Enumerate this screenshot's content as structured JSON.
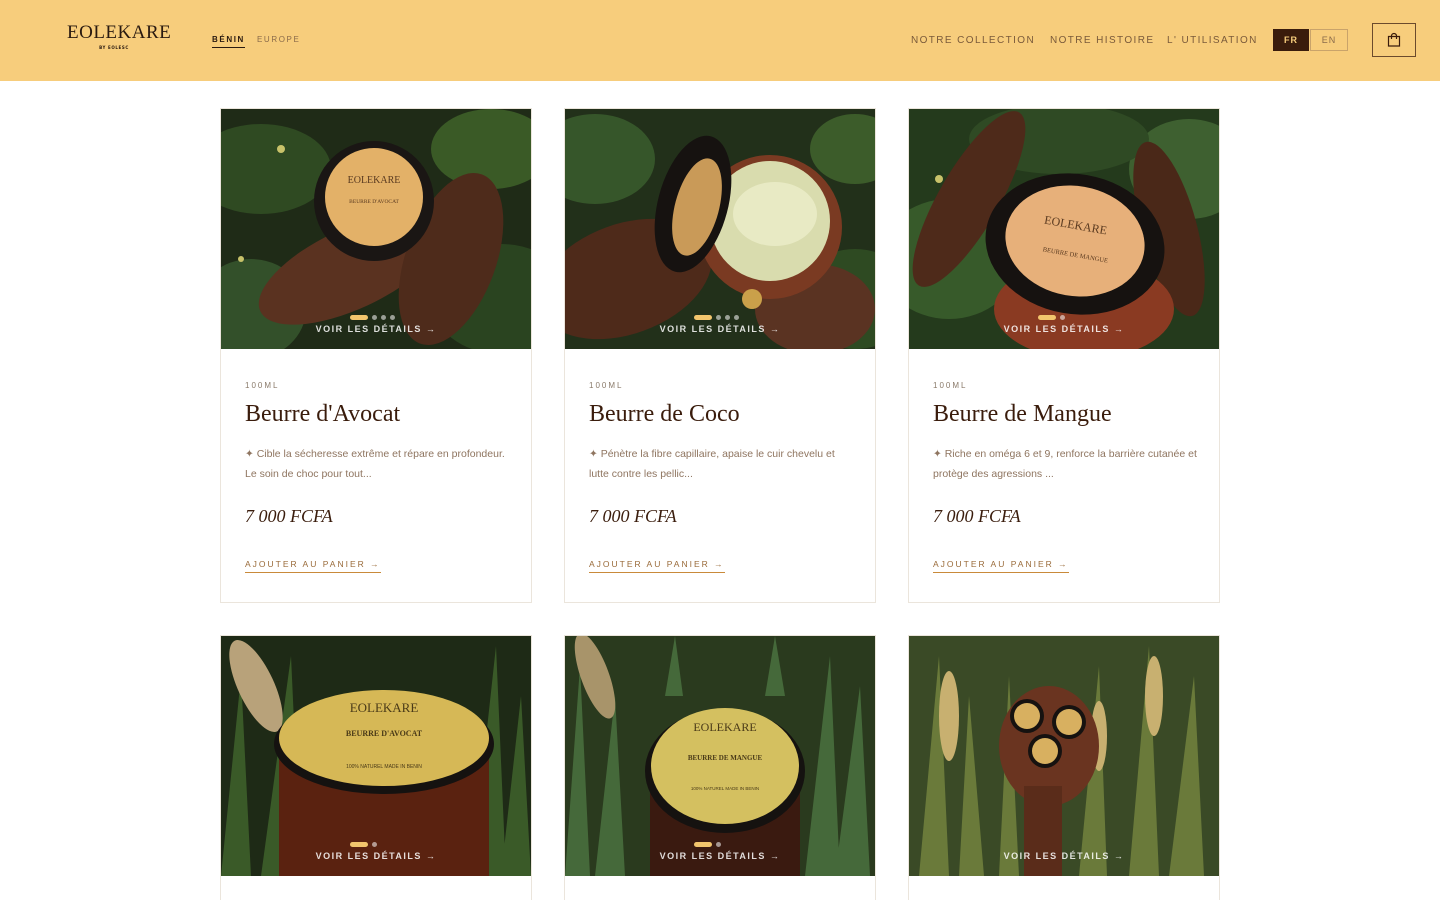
{
  "brand": {
    "name": "EOLEKARE",
    "tagline": "BY EOLESC"
  },
  "regions": {
    "benin": "BÉNIN",
    "europe": "EUROPE"
  },
  "nav": {
    "collection": "NOTRE COLLECTION",
    "histoire": "NOTRE HISTOIRE",
    "utilisation": "L' UTILISATION"
  },
  "lang": {
    "fr": "FR",
    "en": "EN"
  },
  "icons": {
    "cart": "shopping-bag-icon"
  },
  "colors": {
    "header_bg": "#f7cd7c",
    "accent_dark": "#3a1c0c",
    "dot_active": "#f2c56d"
  },
  "products": [
    {
      "volume": "100ML",
      "name": "Beurre d'Avocat",
      "desc": "✦ Cible la sécheresse extrême et répare en profondeur. Le soin de choc pour tout...",
      "price": "7 000 FCFA",
      "add": "AJOUTER AU PANIER →",
      "view": "VOIR LES DÉTAILS →",
      "jar_label": "BEURRE D'AVOCAT",
      "image_count": 4,
      "active_image": 1
    },
    {
      "volume": "100ML",
      "name": "Beurre de Coco",
      "desc": "✦ Pénètre la fibre capillaire, apaise le cuir chevelu et lutte contre les pellic...",
      "price": "7 000 FCFA",
      "add": "AJOUTER AU PANIER →",
      "view": "VOIR LES DÉTAILS →",
      "jar_label": "",
      "image_count": 4,
      "active_image": 1
    },
    {
      "volume": "100ML",
      "name": "Beurre de Mangue",
      "desc": "✦ Riche en oméga 6 et 9, renforce la barrière cutanée et protège des agressions ...",
      "price": "7 000 FCFA",
      "add": "AJOUTER AU PANIER →",
      "view": "VOIR LES DÉTAILS →",
      "jar_label": "BEURRE DE MANGUE",
      "image_count": 2,
      "active_image": 1
    },
    {
      "view": "VOIR LES DÉTAILS →",
      "jar_label": "BEURRE D'AVOCAT",
      "jar_sub": "100% NATUREL MADE IN BENIN",
      "image_count": 2,
      "active_image": 1
    },
    {
      "view": "VOIR LES DÉTAILS →",
      "jar_label": "BEURRE DE MANGUE",
      "jar_sub": "100% NATUREL MADE IN BENIN",
      "image_count": 2,
      "active_image": 1
    },
    {
      "view": "VOIR LES DÉTAILS →",
      "image_count": 1,
      "active_image": 1
    }
  ]
}
